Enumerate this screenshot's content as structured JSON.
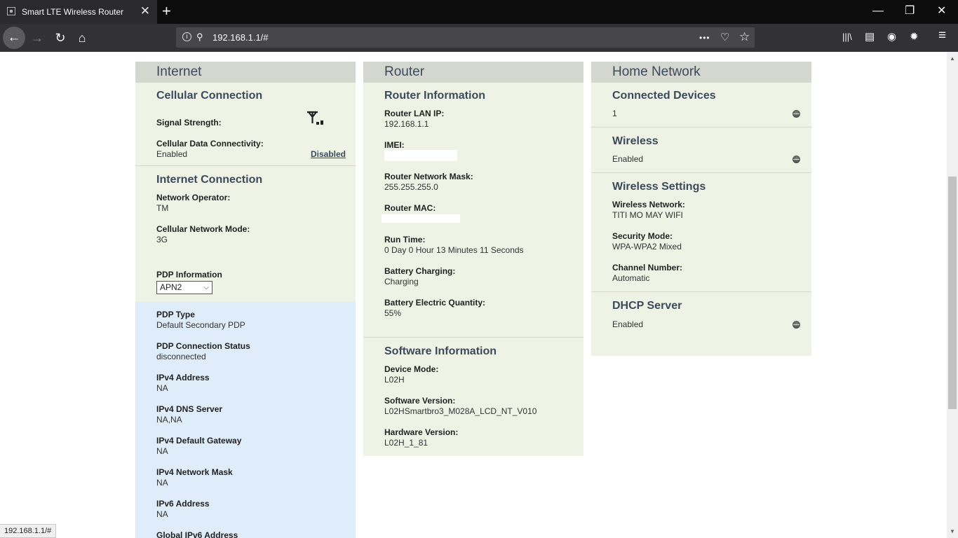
{
  "browser": {
    "tab_title": "Smart LTE Wireless Router",
    "tab_close": "✕",
    "new_tab": "+",
    "url": "192.168.1.1/#",
    "status_url": "192.168.1.1/#",
    "window": {
      "minimize": "—",
      "restore": "❐",
      "close": "✕"
    },
    "icons": {
      "back": "←",
      "forward": "→",
      "reload": "↻",
      "home": "⌂",
      "more": "•••",
      "pocket": "♡",
      "bookmark": "☆",
      "library": "|||\\",
      "sidebar": "▤",
      "account": "◉",
      "extension": "✹",
      "menu": "≡"
    }
  },
  "internet": {
    "header": "Internet",
    "cellular": {
      "title": "Cellular Connection",
      "signal_label": "Signal Strength:",
      "signal_level": 0.25,
      "data_label": "Cellular Data Connectivity:",
      "data_value": "Enabled",
      "data_action": "Disabled"
    },
    "connection": {
      "title": "Internet Connection",
      "operator_label": "Network Operator:",
      "operator_value": "TM",
      "mode_label": "Cellular Network Mode:",
      "mode_value": "3G",
      "pdp_label": "PDP Information",
      "pdp_selected": "APN2",
      "pdp_caret": "⌵"
    },
    "pdp": [
      {
        "label": "PDP Type",
        "value": "Default Secondary PDP"
      },
      {
        "label": "PDP Connection Status",
        "value": "disconnected"
      },
      {
        "label": "IPv4 Address",
        "value": "NA"
      },
      {
        "label": "IPv4 DNS Server",
        "value": "NA,NA"
      },
      {
        "label": "IPv4 Default Gateway",
        "value": "NA"
      },
      {
        "label": "IPv4 Network Mask",
        "value": "NA"
      },
      {
        "label": "IPv6 Address",
        "value": "NA"
      },
      {
        "label": "Global IPv6 Address",
        "value": ""
      }
    ]
  },
  "router": {
    "header": "Router",
    "info_title": "Router Information",
    "info": [
      {
        "label": "Router LAN IP:",
        "value": "192.168.1.1"
      },
      {
        "label": "IMEI:",
        "value": ""
      },
      {
        "label": "Router Network Mask:",
        "value": "255.255.255.0"
      },
      {
        "label": "Router MAC:",
        "value": ""
      },
      {
        "label": "Run Time:",
        "value": "0 Day 0 Hour 13 Minutes 11 Seconds"
      },
      {
        "label": "Battery Charging:",
        "value": "Charging"
      },
      {
        "label": "Battery Electric Quantity:",
        "value": "55%"
      }
    ],
    "software_title": "Software Information",
    "software": [
      {
        "label": "Device Mode:",
        "value": "L02H"
      },
      {
        "label": "Software Version:",
        "value": "L02HSmartbro3_M028A_LCD_NT_V010"
      },
      {
        "label": "Hardware Version:",
        "value": "L02H_1_81"
      }
    ]
  },
  "home": {
    "header": "Home Network",
    "devices_title": "Connected Devices",
    "devices_value": "1",
    "wireless_title": "Wireless",
    "wireless_value": "Enabled",
    "settings_title": "Wireless Settings",
    "settings": [
      {
        "label": "Wireless Network:",
        "value": "TITI MO MAY WIFI"
      },
      {
        "label": "Security Mode:",
        "value": "WPA-WPA2 Mixed"
      },
      {
        "label": "Channel Number:",
        "value": "Automatic"
      }
    ],
    "dhcp_title": "DHCP Server",
    "dhcp_value": "Enabled"
  }
}
